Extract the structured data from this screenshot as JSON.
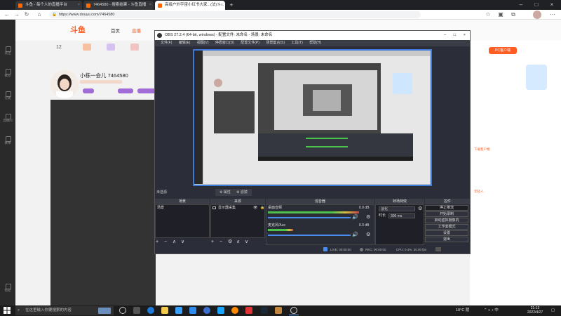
{
  "browser": {
    "tabs": [
      {
        "label": "斗鱼 - 每个人的直播平台"
      },
      {
        "label": "7464580 - 搜索结果 - 斗鱼直播"
      },
      {
        "label": "高级户外宇宙小红书大家...(法)斗..."
      }
    ],
    "url": "https://www.douyu.com/7464580"
  },
  "site": {
    "logo": "斗鱼",
    "nav": [
      "首页",
      "直播"
    ],
    "streamer": {
      "name": "小栋一会儿 7464580",
      "level": "12"
    },
    "right_texts": [
      "PC客户端",
      "下载客户端",
      "年轻人"
    ]
  },
  "left_nav": [
    {
      "label": "关注"
    },
    {
      "label": "推荐"
    },
    {
      "label": "分类"
    },
    {
      "label": "直播间"
    },
    {
      "label": "赛事"
    },
    {
      "label": "帮助"
    }
  ],
  "obs": {
    "title": "OBS 27.2.4 (64-bit, windows) - 配置文件: 未命名 - 场景: 未命名",
    "menu": [
      "文件(F)",
      "编辑(E)",
      "视图(V)",
      "停靠窗口(D)",
      "配置文件(P)",
      "场景集合(S)",
      "工具(T)",
      "帮助(H)"
    ],
    "scene_bar": [
      "未选源",
      "属性",
      "滤镜"
    ],
    "docks": {
      "scenes": {
        "title": "场景",
        "items": [
          "场景"
        ]
      },
      "sources": {
        "title": "来源",
        "items": [
          "显示器采集"
        ]
      },
      "mixer": {
        "title": "混音器",
        "tracks": [
          {
            "name": "桌面音频",
            "db": "0.0 dB"
          },
          {
            "name": "麦克风/Aux",
            "db": "0.0 dB"
          }
        ]
      },
      "transitions": {
        "title": "转场特效",
        "type": "淡化",
        "duration_label": "时长",
        "duration": "300 ms"
      },
      "controls": {
        "title": "控件",
        "buttons": [
          "停止推流",
          "开始录制",
          "启动虚拟摄像机",
          "工作室模式",
          "设置",
          "退出"
        ]
      }
    },
    "status": {
      "live": "LIVE: 00:00:00",
      "rec": "REC: 00:00:00",
      "cpu": "CPU: 0.4%, 30.00 fps"
    }
  },
  "taskbar": {
    "search_placeholder": "在这里输入你要搜索的内容",
    "weather": "10°C 阴",
    "time": "21:13",
    "date": "2022/4/27"
  }
}
